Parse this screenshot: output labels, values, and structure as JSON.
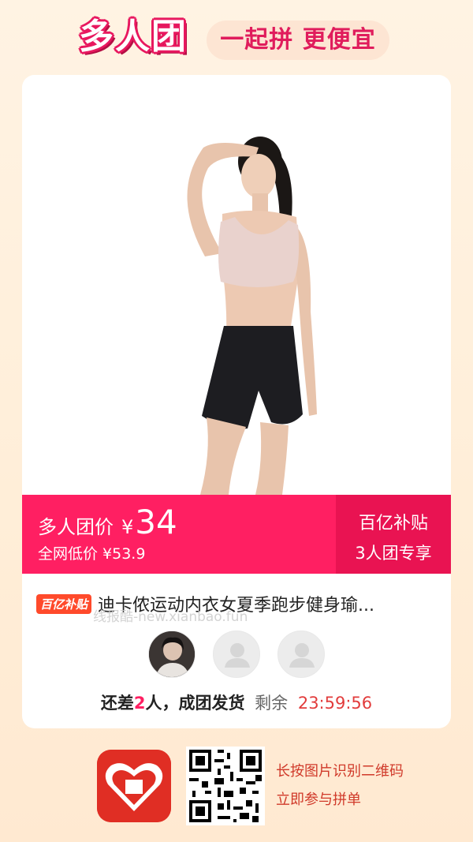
{
  "header": {
    "logo_text": "多人团",
    "slogan": "一起拼 更便宜"
  },
  "price_bar": {
    "group_price_label": "多人团价",
    "currency": "¥",
    "price": "34",
    "original_price_text": "全网低价 ¥53.9",
    "subsidy_title": "百亿补贴",
    "subsidy_sub": "3人团专享"
  },
  "product": {
    "badge": "百亿补贴",
    "title": "迪卡侬运动内衣女夏季跑步健身瑜..."
  },
  "watermark": "线报酷-new.xianbao.fun",
  "avatars": [
    {
      "state": "filled"
    },
    {
      "state": "empty"
    },
    {
      "state": "empty"
    }
  ],
  "status": {
    "prefix": "还差",
    "count": "2",
    "suffix": "人，成团发货",
    "remaining_label": "剩余",
    "timer": "23:59:56"
  },
  "footer": {
    "line1": "长按图片识别二维码",
    "line2": "立即参与拼单"
  },
  "colors": {
    "accent": "#ff1f62",
    "accent_dark": "#e91352",
    "brand_red": "#e02e24"
  },
  "icons": {
    "app_icon": "pinduoduo-app-icon",
    "qr": "qr-code-icon",
    "avatar_placeholder": "user-placeholder-icon"
  }
}
